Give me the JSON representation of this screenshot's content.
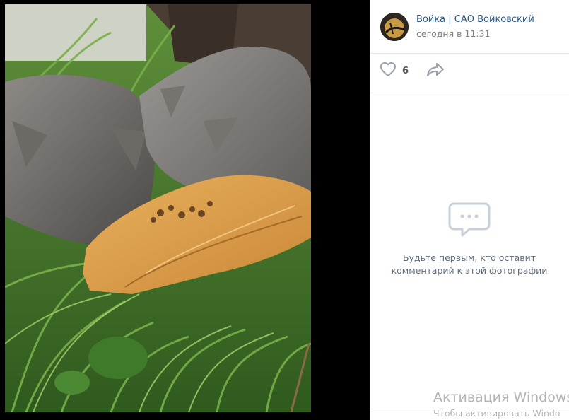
{
  "post": {
    "author": "Войка | САО Войковский",
    "date": "сегодня в 11:31",
    "likes": "6"
  },
  "comments": {
    "empty_line1": "Будьте первым, кто оставит",
    "empty_line2": "комментарий к этой фотографии"
  },
  "watermark": {
    "title": "Активация Windows",
    "subtitle": "Чтобы активировать Windo"
  },
  "icons": {
    "like": "heart-icon",
    "share": "share-arrow-icon",
    "empty": "comments-bubble-icon"
  }
}
